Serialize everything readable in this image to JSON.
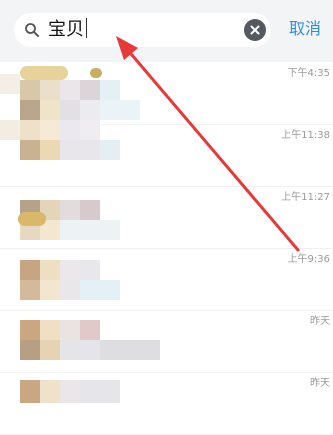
{
  "search": {
    "query": "宝贝",
    "cancel_label": "取消"
  },
  "results": [
    {
      "time": "下午4:35"
    },
    {
      "time": "上午11:38"
    },
    {
      "time": "上午11:27"
    },
    {
      "time": "上午9:36"
    },
    {
      "time": "昨天"
    },
    {
      "time": "昨天"
    }
  ],
  "colors": {
    "accent": "#2b8ee0",
    "annotation_arrow": "#e63a3a",
    "topbar_bg": "#f3f4f6"
  }
}
